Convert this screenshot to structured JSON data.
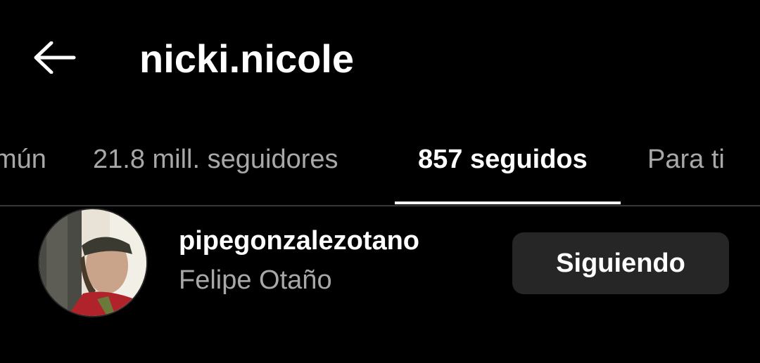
{
  "header": {
    "title": "nicki.nicole",
    "back_icon": "arrow-left-icon"
  },
  "tabs": [
    {
      "label": "mún",
      "active": false
    },
    {
      "label": "21.8 mill. seguidores",
      "active": false
    },
    {
      "label": "857 seguidos",
      "active": true
    },
    {
      "label": "Para ti",
      "active": false
    }
  ],
  "list": {
    "items": [
      {
        "username": "pipegonzalezotano",
        "full_name": "Felipe Otaño",
        "button_label": "Siguiendo"
      }
    ]
  },
  "colors": {
    "background": "#000000",
    "text_primary": "#ffffff",
    "text_secondary": "#a8a8a8",
    "button_bg": "#262626",
    "divider": "#363636"
  }
}
